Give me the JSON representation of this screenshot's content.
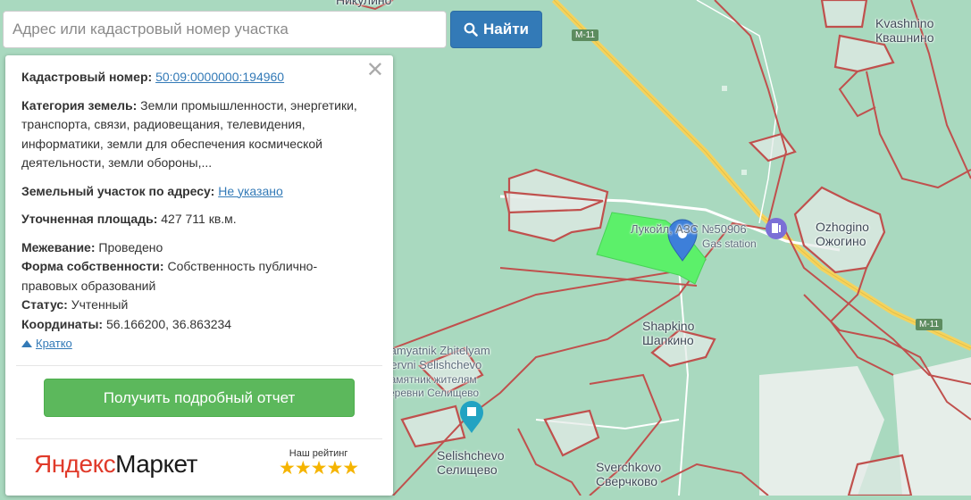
{
  "search": {
    "placeholder": "Адрес или кадастровый номер участка",
    "button_label": "Найти"
  },
  "parcel": {
    "cadastral_label": "Кадастровый номер:",
    "cadastral_number": "50:09:0000000:194960",
    "category_label": "Категория земель:",
    "category_value": "Земли промышленности, энергетики, транспорта, связи, радиовещания, телевидения, информатики, земли для обеспечения космической деятельности, земли обороны,...",
    "address_label": "Земельный участок по адресу:",
    "address_value": "Не указано",
    "area_label": "Уточненная площадь:",
    "area_value": "427 711 кв.м.",
    "survey_label": "Межевание:",
    "survey_value": "Проведено",
    "ownership_label": "Форма собственности:",
    "ownership_value": "Собственность публично-правовых образований",
    "status_label": "Статус:",
    "status_value": "Учтенный",
    "coords_label": "Координаты:",
    "coords_value": "56.166200, 36.863234",
    "collapse_label": "Кратко"
  },
  "report_button_label": "Получить подробный отчет",
  "market": {
    "logo_part1": "Яндекс",
    "logo_part2": "Маркет",
    "rating_label": "Наш рейтинг",
    "rating_stars": 5,
    "stars_text": "★★★★★"
  },
  "map": {
    "road_labels": [
      "M-11",
      "M-11"
    ],
    "places": {
      "top_cut": "Никулино",
      "kvashnino_lat": "Kvashnino",
      "kvashnino_cyr": "Квашнино",
      "ozhogino_lat": "Ozhogino",
      "ozhogino_cyr": "Ожогино",
      "shapkino_lat": "Shapkino",
      "shapkino_cyr": "Шапкино",
      "selishchevo_lat": "Selishchevo",
      "selishchevo_cyr": "Селищево",
      "sverchkovo_lat": "Sverchkovo",
      "sverchkovo_cyr": "Сверчково",
      "monument_lat_1": "Pamyatnik Zhitelyam",
      "monument_lat_2": "Dervni Selishchevo",
      "monument_cyr_1": "Памятник жителям",
      "monument_cyr_2": "деревни Селищево",
      "gas_station_name": "Лукойл, АЗС №50906",
      "gas_station_type": "Gas station"
    },
    "colors": {
      "background": "#a9d9bf",
      "parcel_border": "#c0504d",
      "highlight_parcel": "#5cf06a",
      "road": "#f4d35e",
      "marker": "#3d7fd9"
    }
  }
}
